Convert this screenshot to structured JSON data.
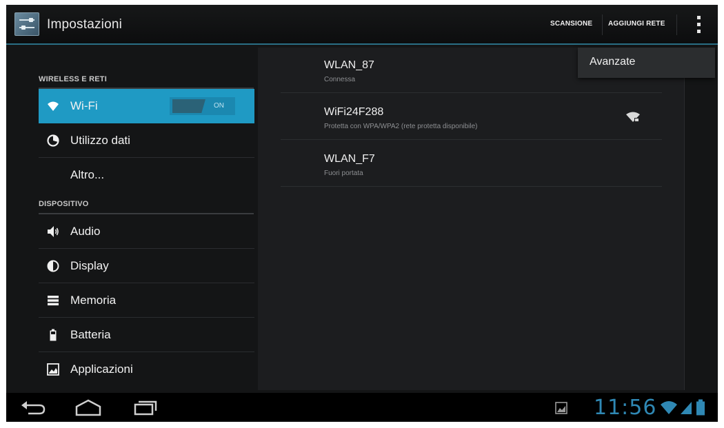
{
  "action_bar": {
    "title": "Impostazioni",
    "scan_label": "SCANSIONE",
    "add_network_label": "AGGIUNGI RETE",
    "overflow_icon": "overflow-menu-icon"
  },
  "sidebar": {
    "sections": [
      {
        "header": "WIRELESS E RETI",
        "items": [
          {
            "label": "Wi-Fi",
            "icon": "wifi-icon",
            "selected": true,
            "toggle": "ON"
          },
          {
            "label": "Utilizzo dati",
            "icon": "data-usage-icon"
          },
          {
            "label": "Altro...",
            "icon": ""
          }
        ]
      },
      {
        "header": "DISPOSITIVO",
        "items": [
          {
            "label": "Audio",
            "icon": "speaker-icon"
          },
          {
            "label": "Display",
            "icon": "display-icon"
          },
          {
            "label": "Memoria",
            "icon": "storage-icon"
          },
          {
            "label": "Batteria",
            "icon": "battery-icon"
          },
          {
            "label": "Applicazioni",
            "icon": "apps-icon"
          }
        ]
      }
    ]
  },
  "networks": [
    {
      "name": "WLAN_87",
      "status": "Connessa"
    },
    {
      "name": "WiFi24F288",
      "status": "Protetta con WPA/WPA2 (rete protetta disponibile)",
      "signal_icon": "wifi-locked-icon"
    },
    {
      "name": "WLAN_F7",
      "status": "Fuori portata"
    }
  ],
  "overflow_menu": {
    "items": [
      "Avanzate"
    ]
  },
  "system_bar": {
    "clock": "11:56"
  },
  "colors": {
    "accent": "#1f9ac4",
    "action_bar_divider": "#2a6f86",
    "clock": "#2f88b4"
  }
}
